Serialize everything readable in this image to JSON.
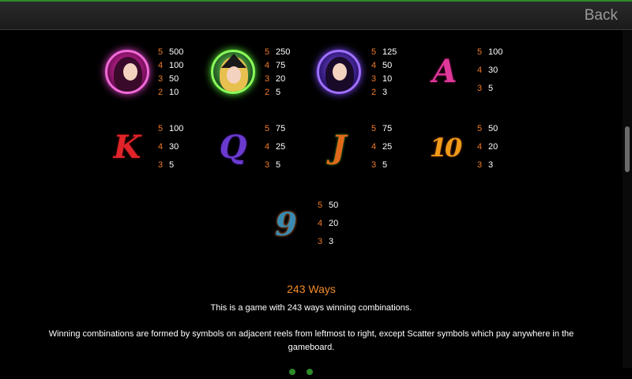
{
  "header": {
    "back_label": "Back"
  },
  "paytable": [
    {
      "symbol": "pink-witch-orb",
      "pays": [
        {
          "count": "5",
          "value": "500"
        },
        {
          "count": "4",
          "value": "100"
        },
        {
          "count": "3",
          "value": "50"
        },
        {
          "count": "2",
          "value": "10"
        }
      ]
    },
    {
      "symbol": "green-witch-orb",
      "pays": [
        {
          "count": "5",
          "value": "250"
        },
        {
          "count": "4",
          "value": "75"
        },
        {
          "count": "3",
          "value": "20"
        },
        {
          "count": "2",
          "value": "5"
        }
      ]
    },
    {
      "symbol": "purple-witch-orb",
      "pays": [
        {
          "count": "5",
          "value": "125"
        },
        {
          "count": "4",
          "value": "50"
        },
        {
          "count": "3",
          "value": "10"
        },
        {
          "count": "2",
          "value": "3"
        }
      ]
    },
    {
      "symbol": "A",
      "pays": [
        {
          "count": "5",
          "value": "100"
        },
        {
          "count": "4",
          "value": "30"
        },
        {
          "count": "3",
          "value": "5"
        }
      ]
    },
    {
      "symbol": "K",
      "pays": [
        {
          "count": "5",
          "value": "100"
        },
        {
          "count": "4",
          "value": "30"
        },
        {
          "count": "3",
          "value": "5"
        }
      ]
    },
    {
      "symbol": "Q",
      "pays": [
        {
          "count": "5",
          "value": "75"
        },
        {
          "count": "4",
          "value": "25"
        },
        {
          "count": "3",
          "value": "5"
        }
      ]
    },
    {
      "symbol": "J",
      "pays": [
        {
          "count": "5",
          "value": "75"
        },
        {
          "count": "4",
          "value": "25"
        },
        {
          "count": "3",
          "value": "5"
        }
      ]
    },
    {
      "symbol": "10",
      "pays": [
        {
          "count": "5",
          "value": "50"
        },
        {
          "count": "4",
          "value": "20"
        },
        {
          "count": "3",
          "value": "3"
        }
      ]
    },
    {
      "symbol": "9",
      "pays": [
        {
          "count": "5",
          "value": "50"
        },
        {
          "count": "4",
          "value": "20"
        },
        {
          "count": "3",
          "value": "3"
        }
      ]
    }
  ],
  "ways": {
    "title": "243 Ways",
    "description": "This is a game with 243 ways winning combinations.",
    "rule": "Winning combinations are formed by symbols on adjacent reels from leftmost to right, except Scatter symbols which pay anywhere in the gameboard."
  },
  "colors": {
    "pay_count": "#f07a28",
    "pay_value": "#ffffff",
    "title_orange": "#f08a2a",
    "accent_green": "#2f8a2a"
  }
}
